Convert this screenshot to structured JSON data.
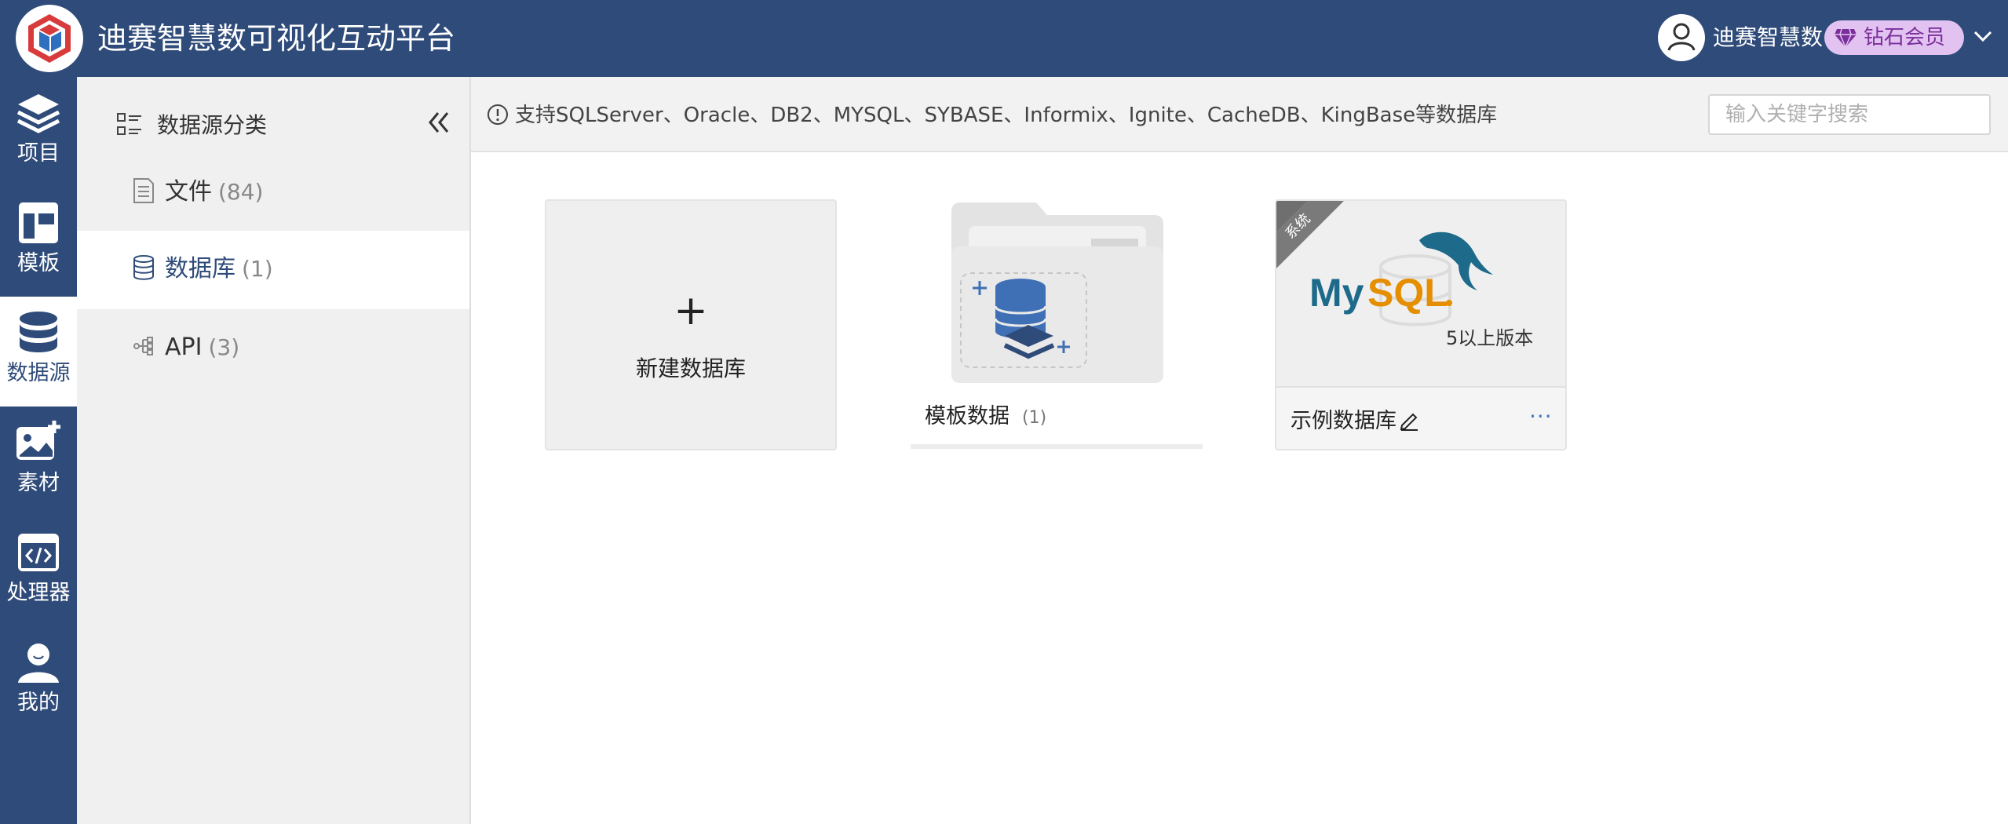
{
  "header": {
    "app_title": "迪赛智慧数可视化互动平台",
    "user_name": "迪赛智慧数",
    "vip_label": "钻石会员",
    "brand_color": "#2f4b79",
    "vip_color": "#e2c2f0"
  },
  "leftnav": {
    "items": [
      {
        "label": "项目",
        "icon": "layers-icon",
        "active": false
      },
      {
        "label": "模板",
        "icon": "template-icon",
        "active": false
      },
      {
        "label": "数据源",
        "icon": "database-icon",
        "active": true
      },
      {
        "label": "素材",
        "icon": "image-add-icon",
        "active": false
      },
      {
        "label": "处理器",
        "icon": "code-window-icon",
        "active": false
      },
      {
        "label": "我的",
        "icon": "user-icon",
        "active": false
      }
    ]
  },
  "category": {
    "title": "数据源分类",
    "items": [
      {
        "name": "文件",
        "count": "(84)",
        "icon": "file-icon",
        "active": false
      },
      {
        "name": "数据库",
        "count": "(1)",
        "icon": "database-icon",
        "active": true
      },
      {
        "name": "API",
        "count": "(3)",
        "icon": "api-icon",
        "active": false
      }
    ]
  },
  "infobar": {
    "text": "支持SQLServer、Oracle、DB2、MYSQL、SYBASE、Informix、Ignite、CacheDB、KingBase等数据库",
    "search_placeholder": "输入关键字搜索"
  },
  "cards": {
    "new_db": {
      "plus": "+",
      "label": "新建数据库"
    },
    "template": {
      "name": "模板数据",
      "count": "(1)"
    },
    "sample": {
      "ribbon": "系统",
      "version": "5以上版本",
      "name": "示例数据库",
      "more": "···"
    }
  }
}
